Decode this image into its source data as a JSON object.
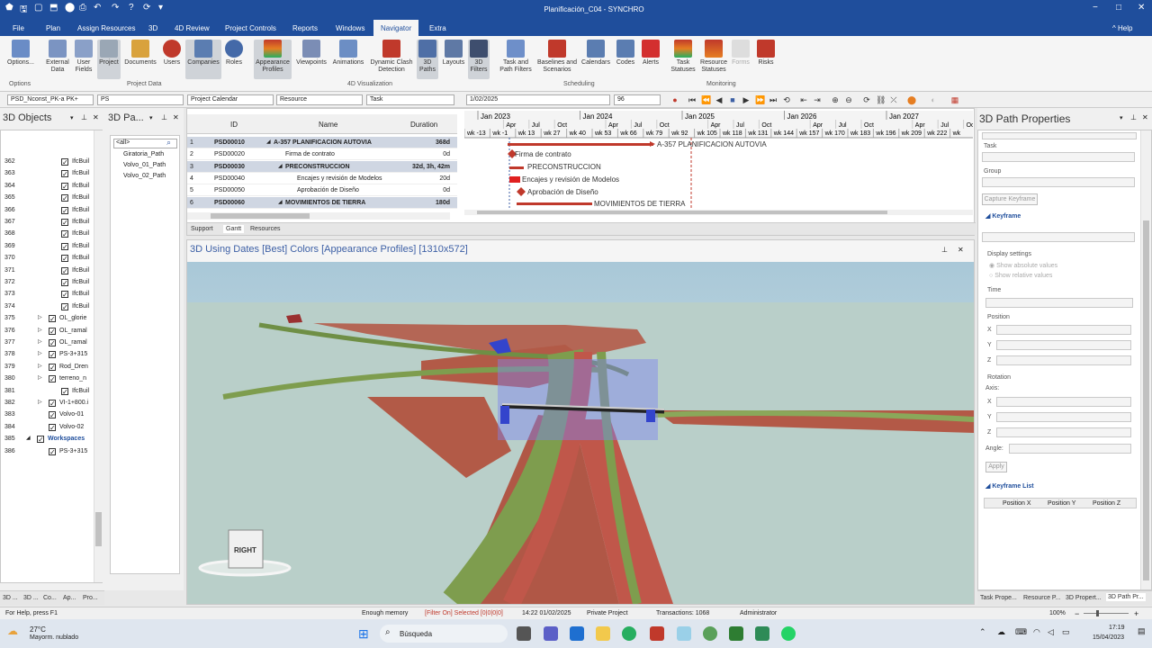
{
  "window": {
    "title": "Planificación_C04 - SYNCHRO",
    "help_label": "Help",
    "minimize": "−",
    "maximize": "□",
    "close": "✕"
  },
  "menu": {
    "items": [
      "File",
      "Plan",
      "Assign Resources",
      "3D",
      "4D Review",
      "Project Controls",
      "Reports",
      "Windows",
      "Navigator",
      "Extra"
    ],
    "active": "Navigator"
  },
  "ribbon": {
    "buttons": [
      {
        "label": "Options...",
        "icon": "options-icon"
      },
      {
        "label": "External Data",
        "icon": "external-data-icon"
      },
      {
        "label": "User Fields",
        "icon": "user-fields-icon"
      },
      {
        "label": "Project",
        "icon": "project-icon"
      },
      {
        "label": "Documents",
        "icon": "documents-icon"
      },
      {
        "label": "Users",
        "icon": "users-icon"
      },
      {
        "label": "Companies",
        "icon": "companies-icon"
      },
      {
        "label": "Roles",
        "icon": "roles-icon"
      },
      {
        "label": "Appearance Profiles",
        "icon": "appearance-profiles-icon"
      },
      {
        "label": "Viewpoints",
        "icon": "viewpoints-icon"
      },
      {
        "label": "Animations",
        "icon": "animations-icon"
      },
      {
        "label": "Dynamic Clash Detection",
        "icon": "clash-detection-icon"
      },
      {
        "label": "3D Paths",
        "icon": "3d-paths-icon"
      },
      {
        "label": "Layouts",
        "icon": "layouts-icon"
      },
      {
        "label": "3D Filters",
        "icon": "3d-filters-icon"
      },
      {
        "label": "Task and Path Filters",
        "icon": "task-filters-icon"
      },
      {
        "label": "Baselines and Scenarios",
        "icon": "baselines-icon"
      },
      {
        "label": "Calendars",
        "icon": "calendars-icon"
      },
      {
        "label": "Codes",
        "icon": "codes-icon"
      },
      {
        "label": "Alerts",
        "icon": "alerts-icon"
      },
      {
        "label": "Task Statuses",
        "icon": "task-statuses-icon"
      },
      {
        "label": "Resource Statuses",
        "icon": "resource-statuses-icon"
      },
      {
        "label": "Forms",
        "icon": "forms-icon"
      },
      {
        "label": "Risks",
        "icon": "risks-icon"
      }
    ],
    "groups": [
      "Options",
      "Project Data",
      "4D Visualization",
      "Scheduling",
      "Monitoring"
    ]
  },
  "toolbar": {
    "combo_pk": "PSD_Nconst_PK-a PK+",
    "combo_ps": "PS",
    "calendar": "Project Calendar",
    "resource": "Resource",
    "task": "Task",
    "date": "1/02/2025",
    "number": "96"
  },
  "objects_panel": {
    "title": "3D Objects",
    "rows": [
      {
        "n": "362",
        "label": "IfcBuil",
        "indent": 2,
        "checked": true,
        "expand": false
      },
      {
        "n": "363",
        "label": "IfcBuil",
        "indent": 2,
        "checked": true,
        "expand": false
      },
      {
        "n": "364",
        "label": "IfcBuil",
        "indent": 2,
        "checked": true,
        "expand": false
      },
      {
        "n": "365",
        "label": "IfcBuil",
        "indent": 2,
        "checked": true,
        "expand": false
      },
      {
        "n": "366",
        "label": "IfcBuil",
        "indent": 2,
        "checked": true,
        "expand": false
      },
      {
        "n": "367",
        "label": "IfcBuil",
        "indent": 2,
        "checked": true,
        "expand": false
      },
      {
        "n": "368",
        "label": "IfcBuil",
        "indent": 2,
        "checked": true,
        "expand": false
      },
      {
        "n": "369",
        "label": "IfcBuil",
        "indent": 2,
        "checked": true,
        "expand": false
      },
      {
        "n": "370",
        "label": "IfcBuil",
        "indent": 2,
        "checked": true,
        "expand": false
      },
      {
        "n": "371",
        "label": "IfcBuil",
        "indent": 2,
        "checked": true,
        "expand": false
      },
      {
        "n": "372",
        "label": "IfcBuil",
        "indent": 2,
        "checked": true,
        "expand": false
      },
      {
        "n": "373",
        "label": "IfcBuil",
        "indent": 2,
        "checked": true,
        "expand": false
      },
      {
        "n": "374",
        "label": "IfcBuil",
        "indent": 2,
        "checked": true,
        "expand": false
      },
      {
        "n": "375",
        "label": "OL_glorie",
        "indent": 1,
        "checked": true,
        "expand": true
      },
      {
        "n": "376",
        "label": "OL_ramal",
        "indent": 1,
        "checked": true,
        "expand": true
      },
      {
        "n": "377",
        "label": "OL_ramal",
        "indent": 1,
        "checked": true,
        "expand": true
      },
      {
        "n": "378",
        "label": "PS-3+315",
        "indent": 1,
        "checked": true,
        "expand": true
      },
      {
        "n": "379",
        "label": "Rod_Dren",
        "indent": 1,
        "checked": true,
        "expand": true
      },
      {
        "n": "380",
        "label": "terreno_n",
        "indent": 1,
        "checked": true,
        "expand": true
      },
      {
        "n": "381",
        "label": "IfcBuil",
        "indent": 2,
        "checked": true,
        "expand": false
      },
      {
        "n": "382",
        "label": "VI-1+800.i",
        "indent": 1,
        "checked": true,
        "expand": true
      },
      {
        "n": "383",
        "label": "Volvo-01",
        "indent": 1,
        "checked": true,
        "expand": false
      },
      {
        "n": "384",
        "label": "Volvo-02",
        "indent": 1,
        "checked": true,
        "expand": false
      },
      {
        "n": "385",
        "label": "Workspaces",
        "indent": 0,
        "checked": true,
        "expand": true
      },
      {
        "n": "386",
        "label": "PS-3+315",
        "indent": 1,
        "checked": true,
        "expand": false
      }
    ]
  },
  "paths_panel": {
    "title": "3D Pa...",
    "filter": "<all>",
    "items": [
      "Giratoria_Path",
      "Volvo_01_Path",
      "Volvo_02_Path"
    ]
  },
  "left_tabs": [
    "3D ...",
    "3D ...",
    "Co...",
    "Ap...",
    "Pro..."
  ],
  "gantt": {
    "headers": [
      "ID",
      "Name",
      "Duration"
    ],
    "rows": [
      {
        "n": "1",
        "id": "PSD00010",
        "name": "A-357 PLANIFICACION AUTOVIA",
        "dur": "368d",
        "summary": true,
        "level": 0
      },
      {
        "n": "2",
        "id": "PSD00020",
        "name": "Firma de contrato",
        "dur": "0d",
        "summary": false,
        "level": 1
      },
      {
        "n": "3",
        "id": "PSD00030",
        "name": "PRECONSTRUCCION",
        "dur": "32d, 3h, 42m",
        "summary": true,
        "level": 1
      },
      {
        "n": "4",
        "id": "PSD00040",
        "name": "Encajes y revisión de Modelos",
        "dur": "20d",
        "summary": false,
        "level": 2
      },
      {
        "n": "5",
        "id": "PSD00050",
        "name": "Aprobación de Diseño",
        "dur": "0d",
        "summary": false,
        "level": 2
      },
      {
        "n": "6",
        "id": "PSD00060",
        "name": "MOVIMIENTOS DE TIERRA",
        "dur": "180d",
        "summary": true,
        "level": 1
      }
    ],
    "years": [
      "Jan 2023",
      "Jan 2024",
      "Jan 2025",
      "Jan 2026",
      "Jan 2027"
    ],
    "months": [
      "Apr",
      "Jul",
      "Oct",
      "Apr",
      "Jul",
      "Oct",
      "Apr",
      "Jul",
      "Oct",
      "Apr",
      "Jul",
      "Oct",
      "Apr",
      "Jul",
      "Oct"
    ],
    "weeks": [
      "wk -13",
      "wk -1",
      "wk 13",
      "wk 27",
      "wk 40",
      "wk 53",
      "wk 66",
      "wk 79",
      "wk 92",
      "wk 105",
      "wk 118",
      "wk 131",
      "wk 144",
      "wk 157",
      "wk 170",
      "wk 183",
      "wk 196",
      "wk 209",
      "wk 222",
      "wk"
    ],
    "bar_labels": [
      "A-357 PLANIFICACION AUTOVIA",
      "Firma de contrato",
      "PRECONSTRUCCION",
      "Encajes y revisión de Modelos",
      "Aprobación de Diseño",
      "MOVIMIENTOS DE TIERRA"
    ],
    "tabs": [
      "Support",
      "Gantt",
      "Resources"
    ]
  },
  "viewport": {
    "title": "3D Using Dates [Best] Colors [Appearance Profiles]  [1310x572]",
    "cube_label": "RIGHT"
  },
  "properties": {
    "title": "3D Path Properties",
    "task_label": "Task",
    "group_label": "Group",
    "capture_btn": "Capture Keyframe",
    "keyframe_section": "Keyframe",
    "display_settings": "Display settings",
    "show_absolute": "Show absolute values",
    "show_relative": "Show relative values",
    "time_label": "Time",
    "position_label": "Position",
    "x": "X",
    "y": "Y",
    "z": "Z",
    "rotation_label": "Rotation",
    "axis_label": "Axis:",
    "angle_label": "Angle:",
    "apply_btn": "Apply",
    "keyframe_list": "Keyframe List",
    "cols": [
      "Position X",
      "Position Y",
      "Position Z"
    ],
    "tabs": [
      "Task Prope...",
      "Resource P...",
      "3D Propert...",
      "3D Path Pr..."
    ]
  },
  "status": {
    "help": "For Help, press F1",
    "memory": "Enough memory",
    "filter": "[Filter On]  Selected [0|0|0|0]",
    "datetime": "14:22 01/02/2025",
    "project": "Private Project",
    "transactions": "Transactions: 1068",
    "user": "Administrator",
    "zoom": "100%"
  },
  "taskbar": {
    "weather_temp": "27°C",
    "weather_desc": "Mayorm. nublado",
    "search": "Búsqueda",
    "time": "17:19",
    "date": "15/04/2023"
  }
}
